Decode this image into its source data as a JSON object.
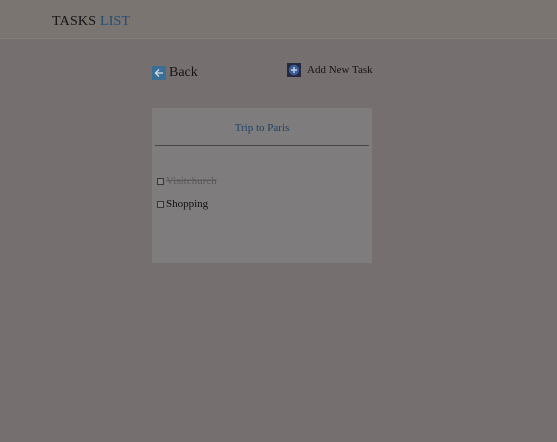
{
  "header": {
    "brand_primary": "TASKS",
    "brand_accent": "LIST"
  },
  "toolbar": {
    "back_label": "Back",
    "add_label": "Add New Task"
  },
  "list": {
    "title": "Trip to Paris",
    "tasks": [
      {
        "label": "Visitchurch",
        "done": true
      },
      {
        "label": "Shopping",
        "done": false
      }
    ]
  },
  "icons": {
    "back": "arrow-left-icon",
    "add": "plus-circle-icon"
  },
  "colors": {
    "accent": "#1d4d7a",
    "back_icon_bg": "#3a6f95",
    "add_icon_bg": "#25283f"
  }
}
